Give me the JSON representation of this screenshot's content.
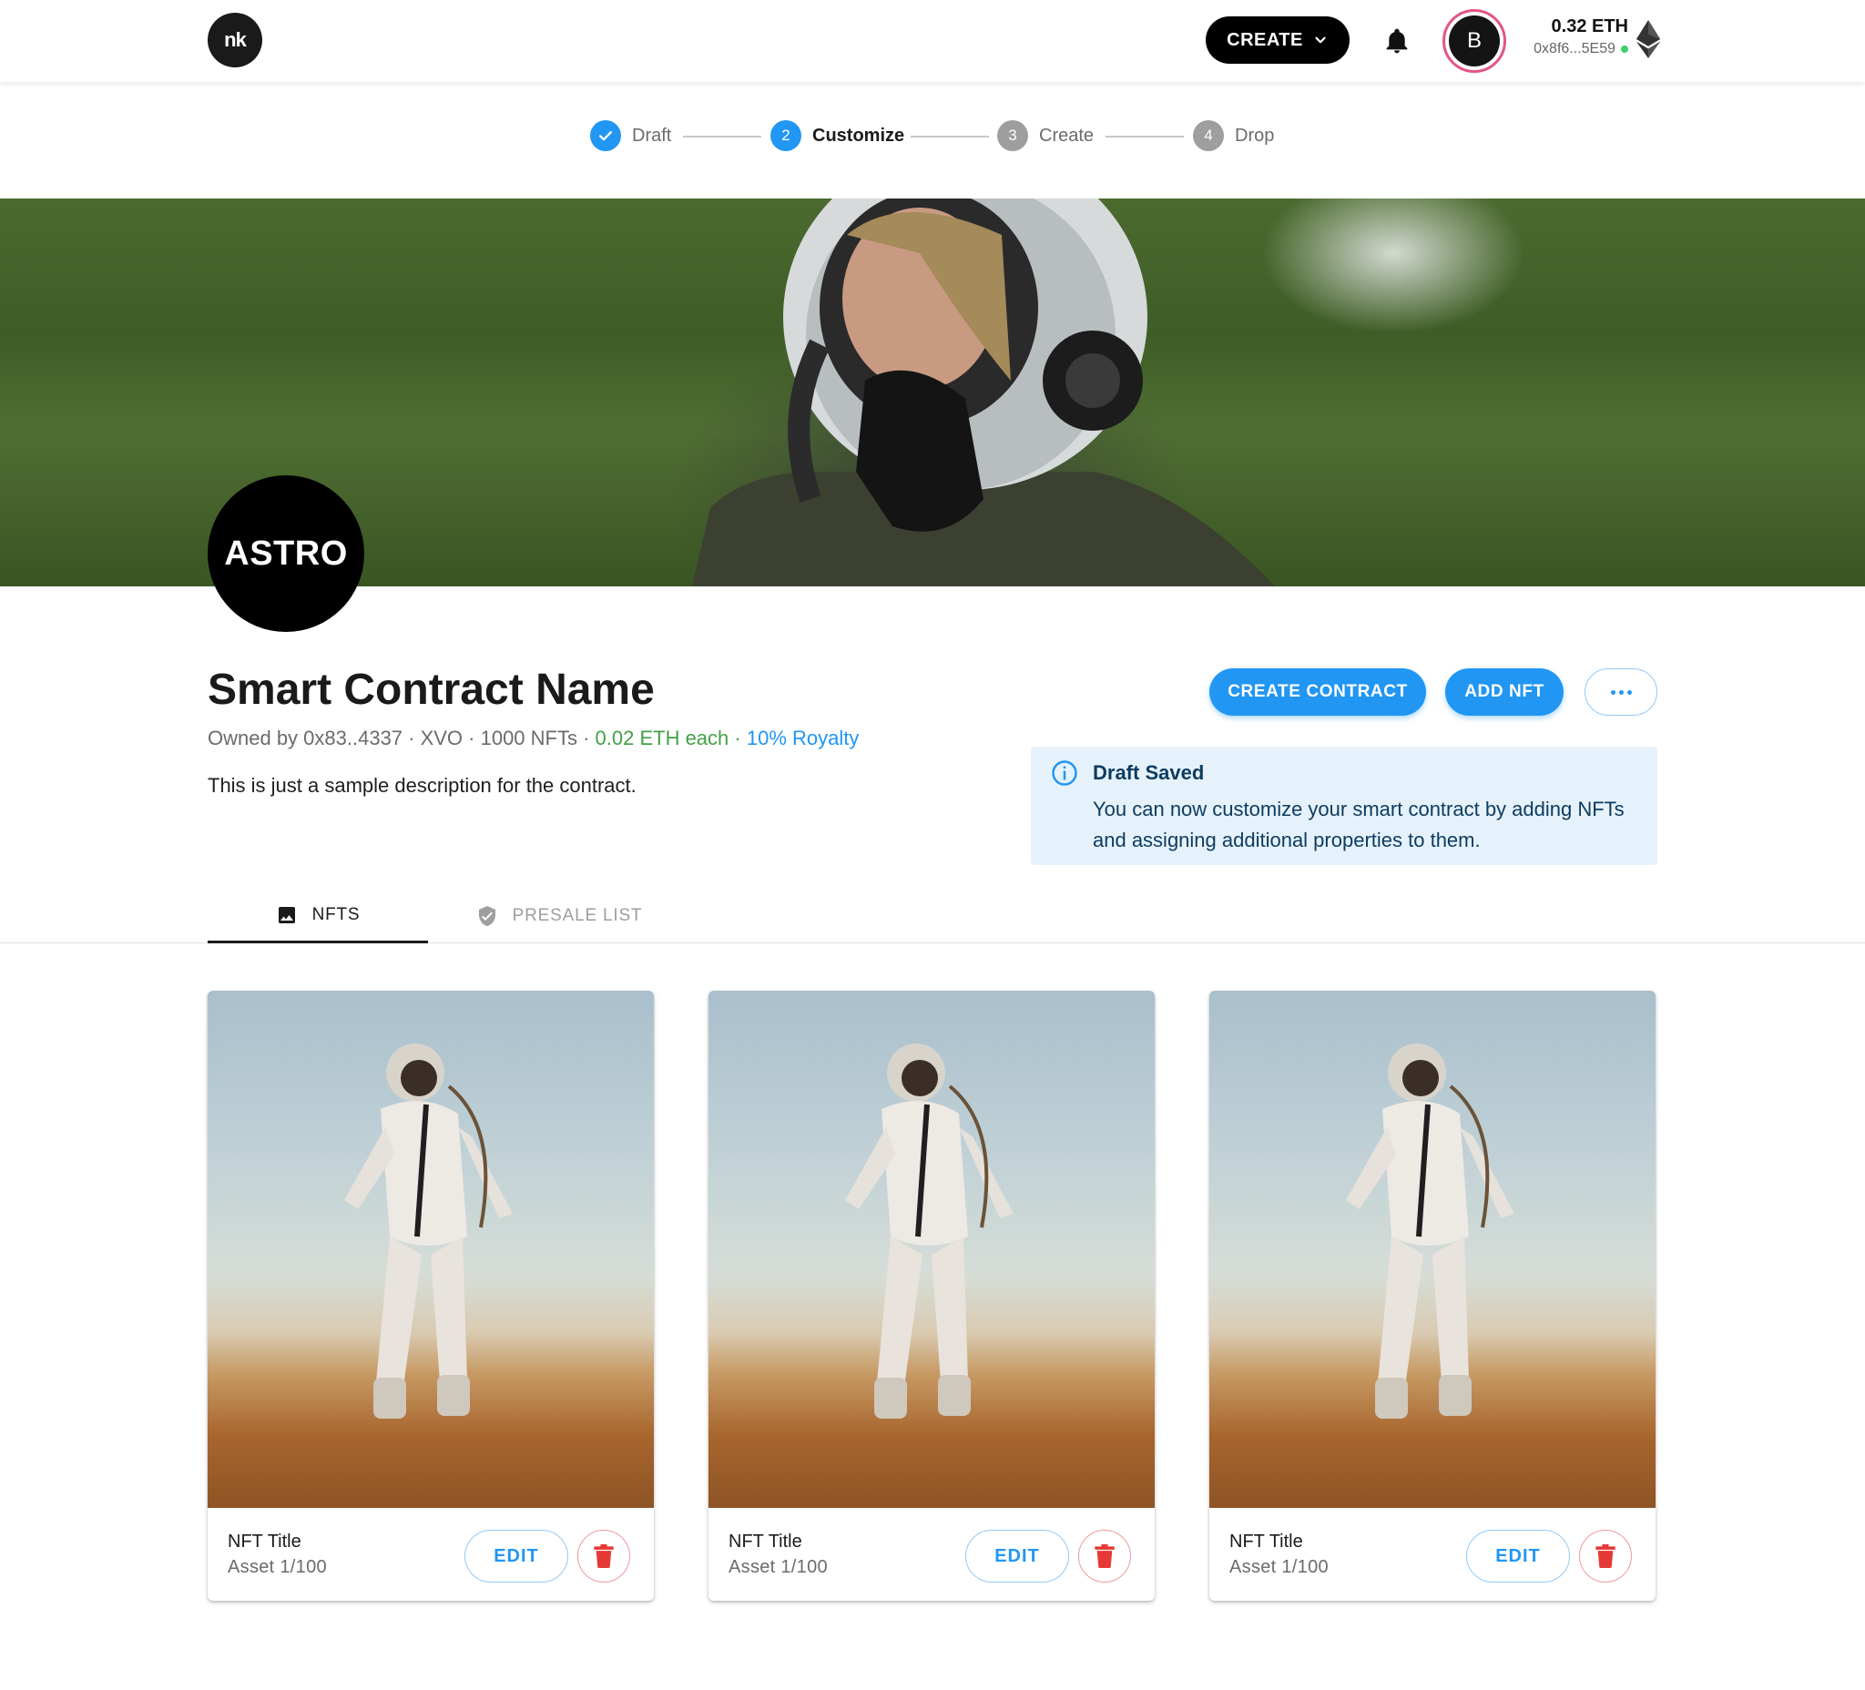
{
  "header": {
    "logo_text": "nk",
    "create_label": "CREATE",
    "avatar_initial": "B",
    "wallet_balance": "0.32 ETH",
    "wallet_address": "0x8f6...5E59"
  },
  "stepper": {
    "steps": [
      {
        "label": "Draft",
        "number": "",
        "state": "done"
      },
      {
        "label": "Customize",
        "number": "2",
        "state": "active"
      },
      {
        "label": "Create",
        "number": "3",
        "state": "pending"
      },
      {
        "label": "Drop",
        "number": "4",
        "state": "pending"
      }
    ]
  },
  "profile": {
    "avatar_text": "ASTRO"
  },
  "contract": {
    "name": "Smart Contract Name",
    "owner_meta": "Owned by 0x83..4337 · XVO · 1000 NFTs · ",
    "price": "0.02 ETH each",
    "separator": " · ",
    "royalty": "10% Royalty",
    "description": "This is just a sample description for the contract."
  },
  "actions": {
    "create_contract": "CREATE CONTRACT",
    "add_nft": "ADD NFT"
  },
  "alert": {
    "title": "Draft Saved",
    "body": "You can now customize your smart contract by adding NFTs and assigning additional properties to them."
  },
  "tabs": [
    {
      "label": "NFTS",
      "active": true
    },
    {
      "label": "PRESALE LIST",
      "active": false
    }
  ],
  "nfts": [
    {
      "title": "NFT Title",
      "subtitle": "Asset 1/100",
      "edit_label": "EDIT"
    },
    {
      "title": "NFT Title",
      "subtitle": "Asset 1/100",
      "edit_label": "EDIT"
    },
    {
      "title": "NFT Title",
      "subtitle": "Asset 1/100",
      "edit_label": "EDIT"
    }
  ],
  "colors": {
    "accent": "#2196f3",
    "price": "#43a047",
    "danger": "#e53935",
    "alert_bg": "#e6f2fb"
  }
}
